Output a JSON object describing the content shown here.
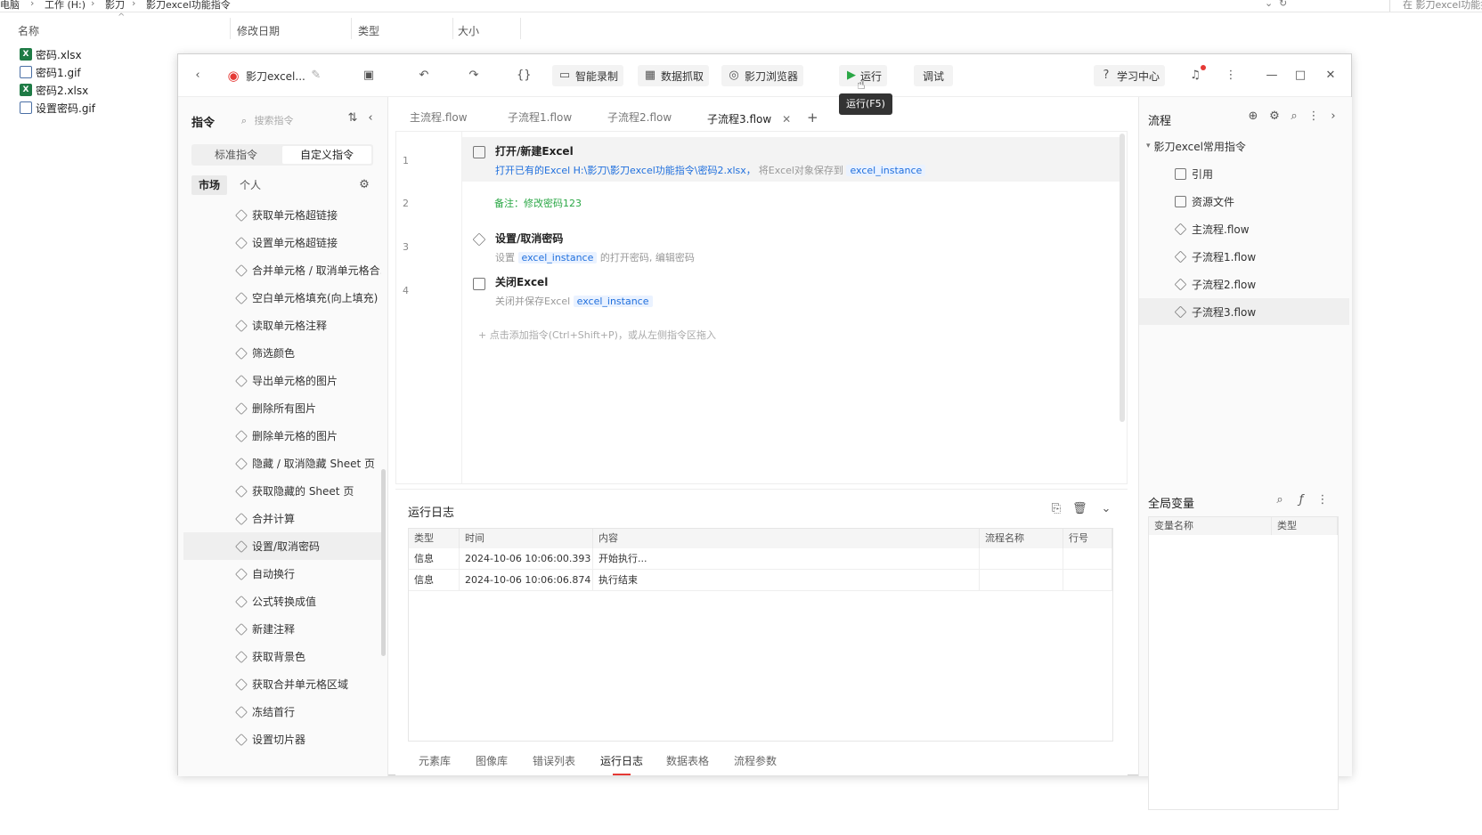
{
  "explorer": {
    "breadcrumb": [
      "电脑",
      "工作 (H:)",
      "影刀",
      "影刀excel功能指令"
    ],
    "search_placeholder": "在 影刀excel功能指",
    "columns": [
      "名称",
      "修改日期",
      "类型",
      "大小"
    ],
    "files": [
      {
        "name": "密码.xlsx",
        "icon": "excel-file-icon"
      },
      {
        "name": "密码1.gif",
        "icon": "image-file-icon"
      },
      {
        "name": "密码2.xlsx",
        "icon": "excel-file-icon"
      },
      {
        "name": "设置密码.gif",
        "icon": "image-file-icon"
      }
    ]
  },
  "app": {
    "title": "影刀excel...",
    "toolbar": {
      "smart_record": "智能录制",
      "data_scrape": "数据抓取",
      "browser": "影刀浏览器",
      "run": "运行",
      "debug": "调试",
      "learning": "学习中心",
      "run_tooltip": "运行(F5)"
    },
    "left": {
      "title": "指令",
      "search_placeholder": "搜索指令",
      "seg_standard": "标准指令",
      "seg_custom": "自定义指令",
      "tab_market": "市场",
      "tab_personal": "个人",
      "commands": [
        "获取单元格超链接",
        "设置单元格超链接",
        "合并单元格 / 取消单元格合...",
        "空白单元格填充(向上填充)",
        "读取单元格注释",
        "筛选颜色",
        "导出单元格的图片",
        "删除所有图片",
        "删除单元格的图片",
        "隐藏 / 取消隐藏 Sheet 页",
        "获取隐藏的 Sheet 页",
        "合并计算",
        "设置/取消密码",
        "自动换行",
        "公式转换成值",
        "新建注释",
        "获取背景色",
        "获取合并单元格区域",
        "冻结首行",
        "设置切片器"
      ]
    },
    "tabs": [
      "主流程.flow",
      "子流程1.flow",
      "子流程2.flow",
      "子流程3.flow"
    ],
    "editor": {
      "line_numbers": [
        "1",
        "2",
        "3",
        "4"
      ],
      "step1_title": "打开/新建Excel",
      "step1_desc": "打开已有的Excel H:\\影刀\\影刀excel功能指令\\密码2.xlsx，",
      "step1_desc2": "将Excel对象保存到",
      "step1_var": "excel_instance",
      "note": "备注：修改密码123",
      "step3_title": "设置/取消密码",
      "step3_desc_a": "设置",
      "step3_var": "excel_instance",
      "step3_desc_b": "的打开密码, 编辑密码",
      "step4_title": "关闭Excel",
      "step4_desc": "关闭并保存Excel",
      "step4_var": "excel_instance",
      "add_hint": "点击添加指令(Ctrl+Shift+P)，或从左侧指令区拖入"
    },
    "log": {
      "title": "运行日志",
      "headers": [
        "类型",
        "时间",
        "内容",
        "流程名称",
        "行号"
      ],
      "rows": [
        {
          "type": "信息",
          "time": "2024-10-06 10:06:00.393",
          "content": "开始执行..."
        },
        {
          "type": "信息",
          "time": "2024-10-06 10:06:06.874",
          "content": "执行结束"
        }
      ],
      "bottom_tabs": [
        "元素库",
        "图像库",
        "错误列表",
        "运行日志",
        "数据表格",
        "流程参数"
      ]
    },
    "right": {
      "title": "流程",
      "tree_root": "影刀excel常用指令",
      "tree_items": [
        "引用",
        "资源文件",
        "主流程.flow",
        "子流程1.flow",
        "子流程2.flow",
        "子流程3.flow"
      ],
      "vars_title": "全局变量",
      "var_headers": [
        "变量名称",
        "类型"
      ]
    }
  }
}
